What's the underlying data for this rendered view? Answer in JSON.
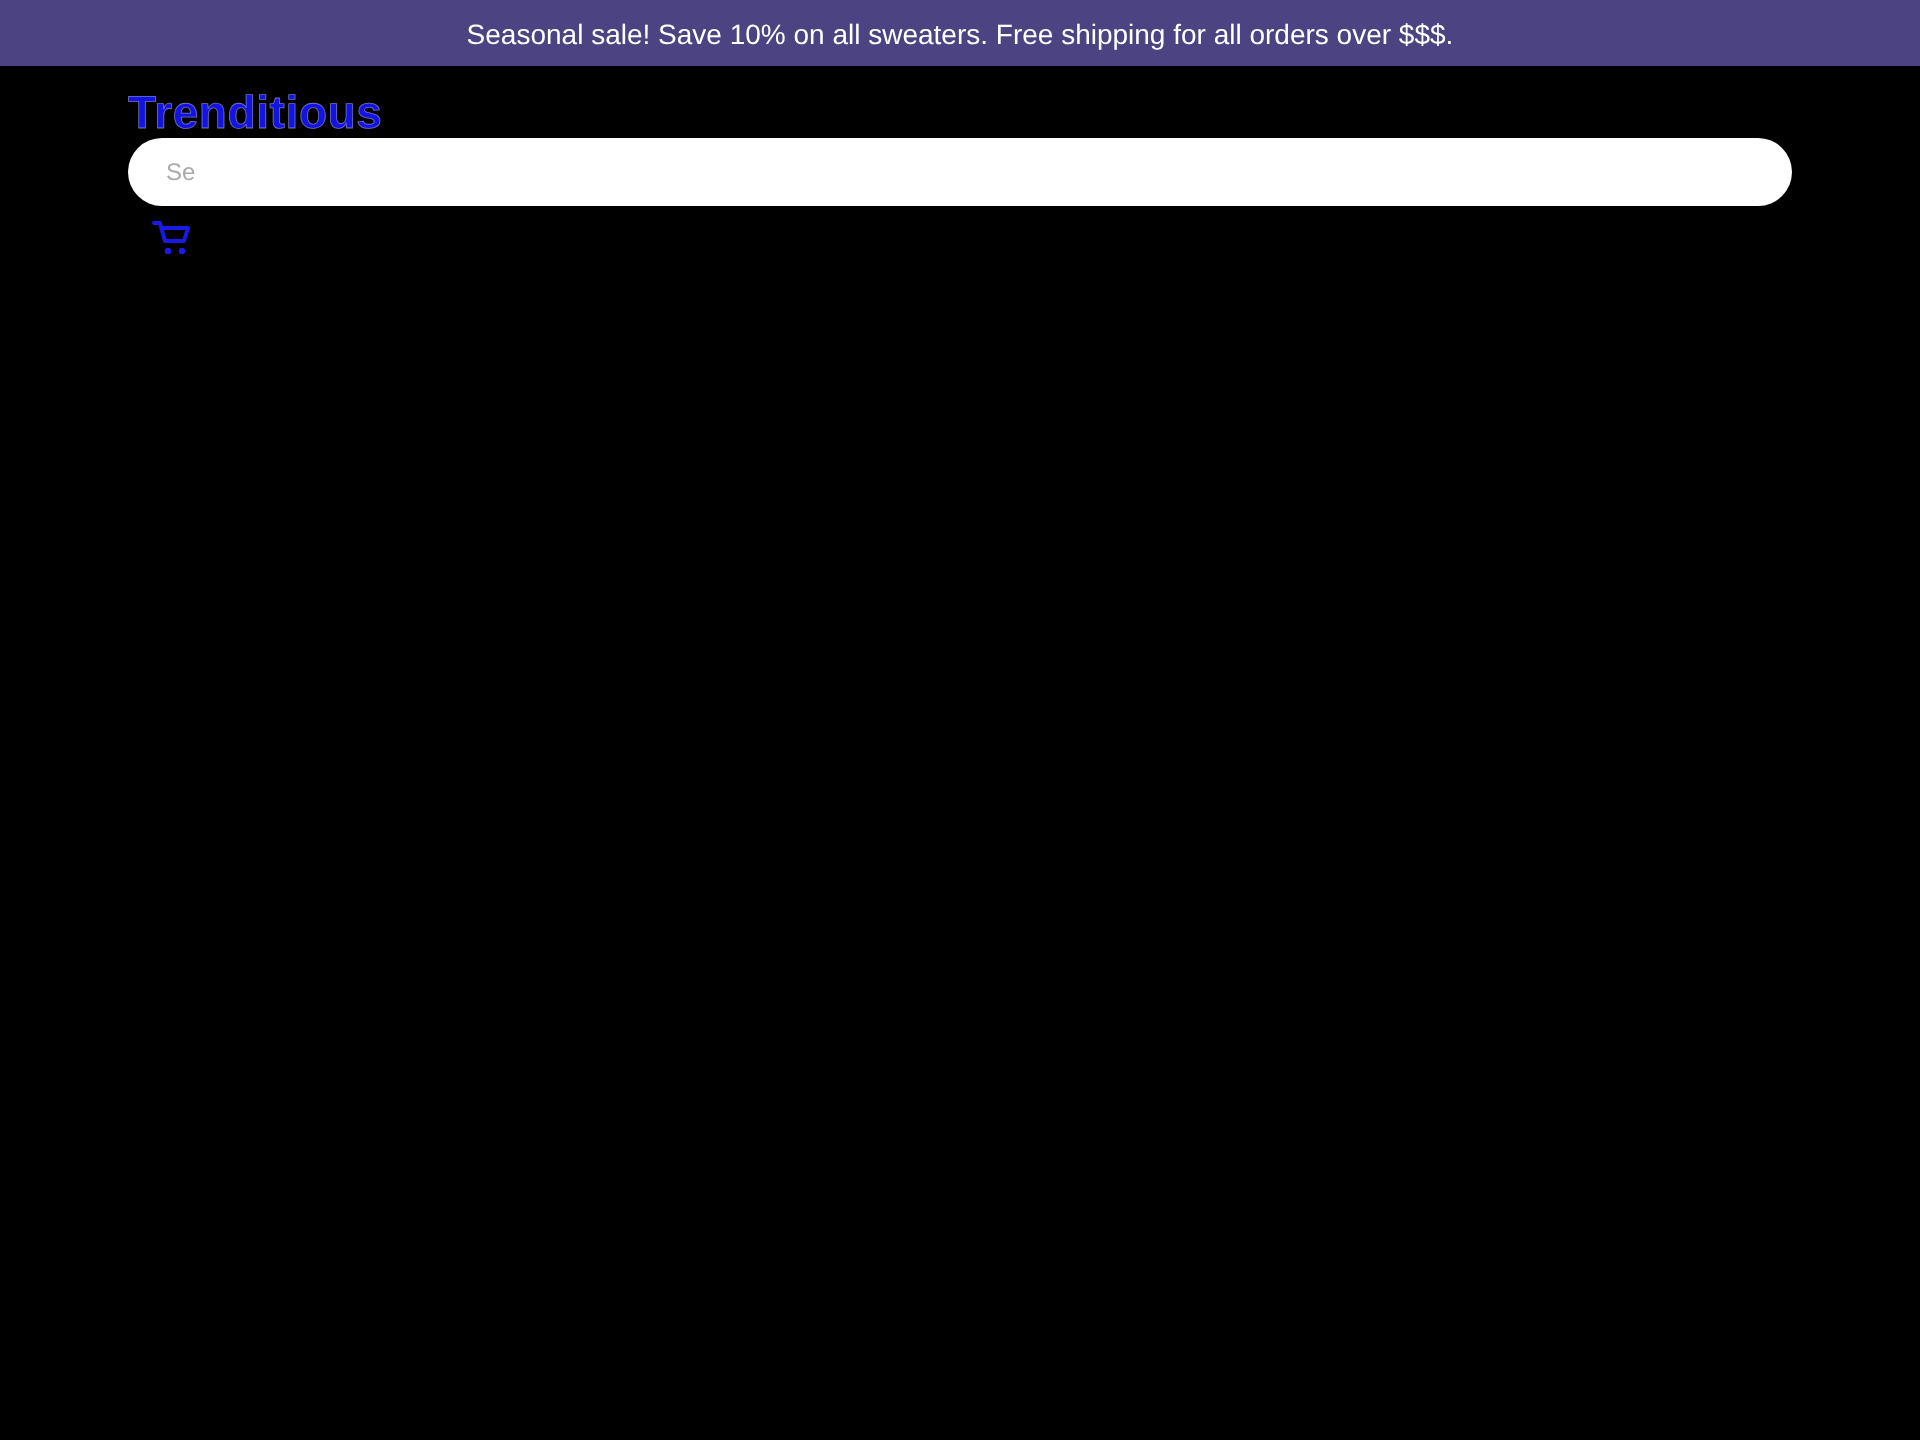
{
  "announcement_bar": {
    "text": "Seasonal sale! Save 10% on all sweaters. Free shipping for all orders over $$$."
  },
  "header": {
    "logo": "Trenditious",
    "search": {
      "placeholder": "Se"
    }
  }
}
